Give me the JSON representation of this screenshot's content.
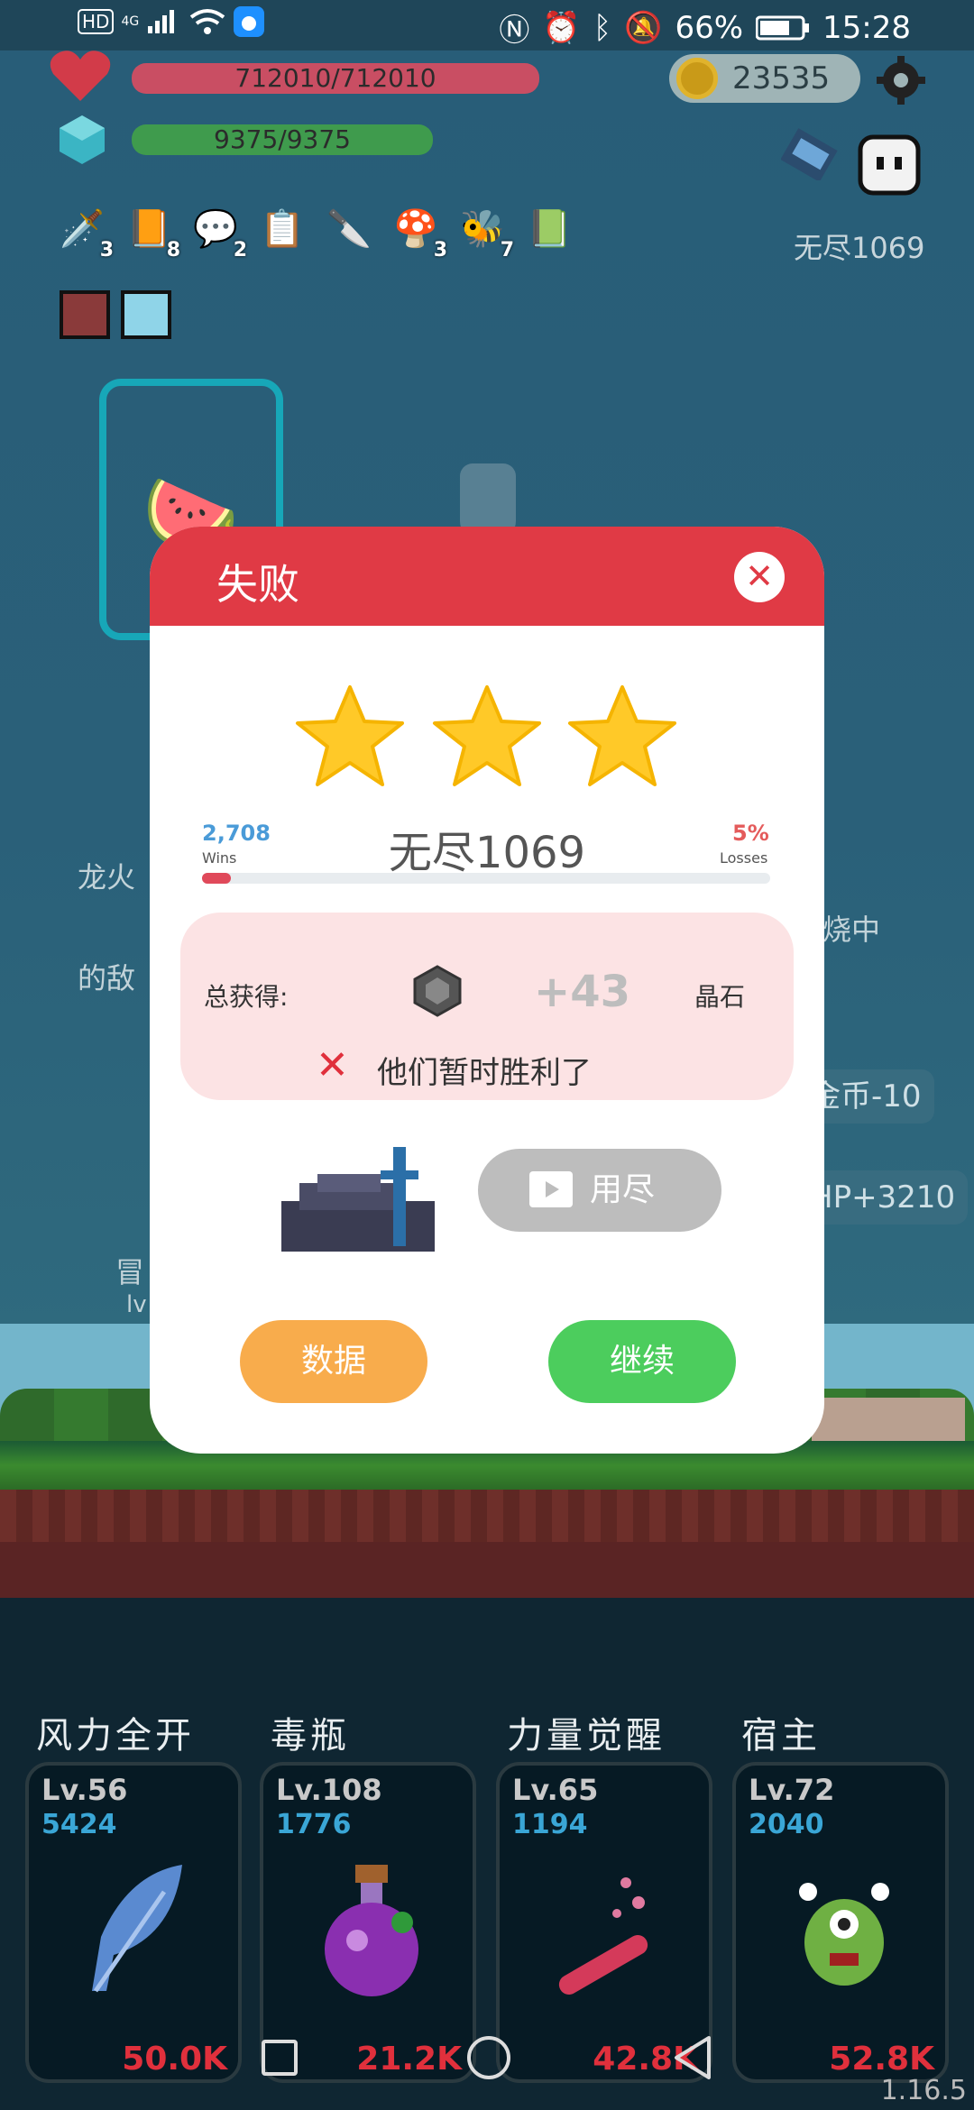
{
  "status_bar": {
    "network": "HD",
    "signal": "4G",
    "battery_percent": "66%",
    "time": "15:28"
  },
  "hud": {
    "hp": "712010/712010",
    "mp": "9375/9375",
    "coins": "23535",
    "endless_stage": "无尽1069",
    "items": [
      {
        "icon": "sword-icon",
        "count": "3"
      },
      {
        "icon": "book-icon",
        "count": "8"
      },
      {
        "icon": "chat-bubble-icon",
        "count": "2"
      },
      {
        "icon": "scroll-icon",
        "count": ""
      },
      {
        "icon": "dagger-icon",
        "count": ""
      },
      {
        "icon": "mushroom-icon",
        "count": "3"
      },
      {
        "icon": "bee-icon",
        "count": "7"
      },
      {
        "icon": "card-icon",
        "count": ""
      }
    ]
  },
  "background": {
    "text_left_1": "龙火",
    "text_left_2": "的敌",
    "text_right_1": "烧中",
    "chip_gold": "金币-10",
    "chip_hp": "HP+3210",
    "adventure_text": "冒",
    "adventure_lv": "lv"
  },
  "dialog": {
    "title": "失败",
    "close_icon": "close-icon",
    "stars": 3,
    "wins_value": "2,708",
    "wins_label": "Wins",
    "losses_value": "5%",
    "losses_label": "Losses",
    "level_name": "无尽1069",
    "progress": 0.05,
    "reward_label": "总获得:",
    "reward_amount": "+43",
    "reward_unit": "晶石",
    "fail_message": "他们暂时胜利了",
    "exhausted_label": "用尽",
    "data_button": "数据",
    "continue_button": "继续"
  },
  "skills": [
    {
      "name": "风力全开",
      "level": "Lv.56",
      "power": "5424",
      "cost": "50.0K",
      "icon": "feather-icon"
    },
    {
      "name": "毒瓶",
      "level": "Lv.108",
      "power": "1776",
      "cost": "21.2K",
      "icon": "poison-bottle-icon"
    },
    {
      "name": "力量觉醒",
      "level": "Lv.65",
      "power": "1194",
      "cost": "42.8K",
      "icon": "test-tube-icon"
    },
    {
      "name": "宿主",
      "level": "Lv.72",
      "power": "2040",
      "cost": "52.8K",
      "icon": "monster-icon"
    }
  ],
  "version": "1.16.5",
  "colors": {
    "dialog_header": "#e03a45",
    "continue": "#4ccd5d",
    "data": "#f8ac4c",
    "cost": "#e0303c"
  }
}
